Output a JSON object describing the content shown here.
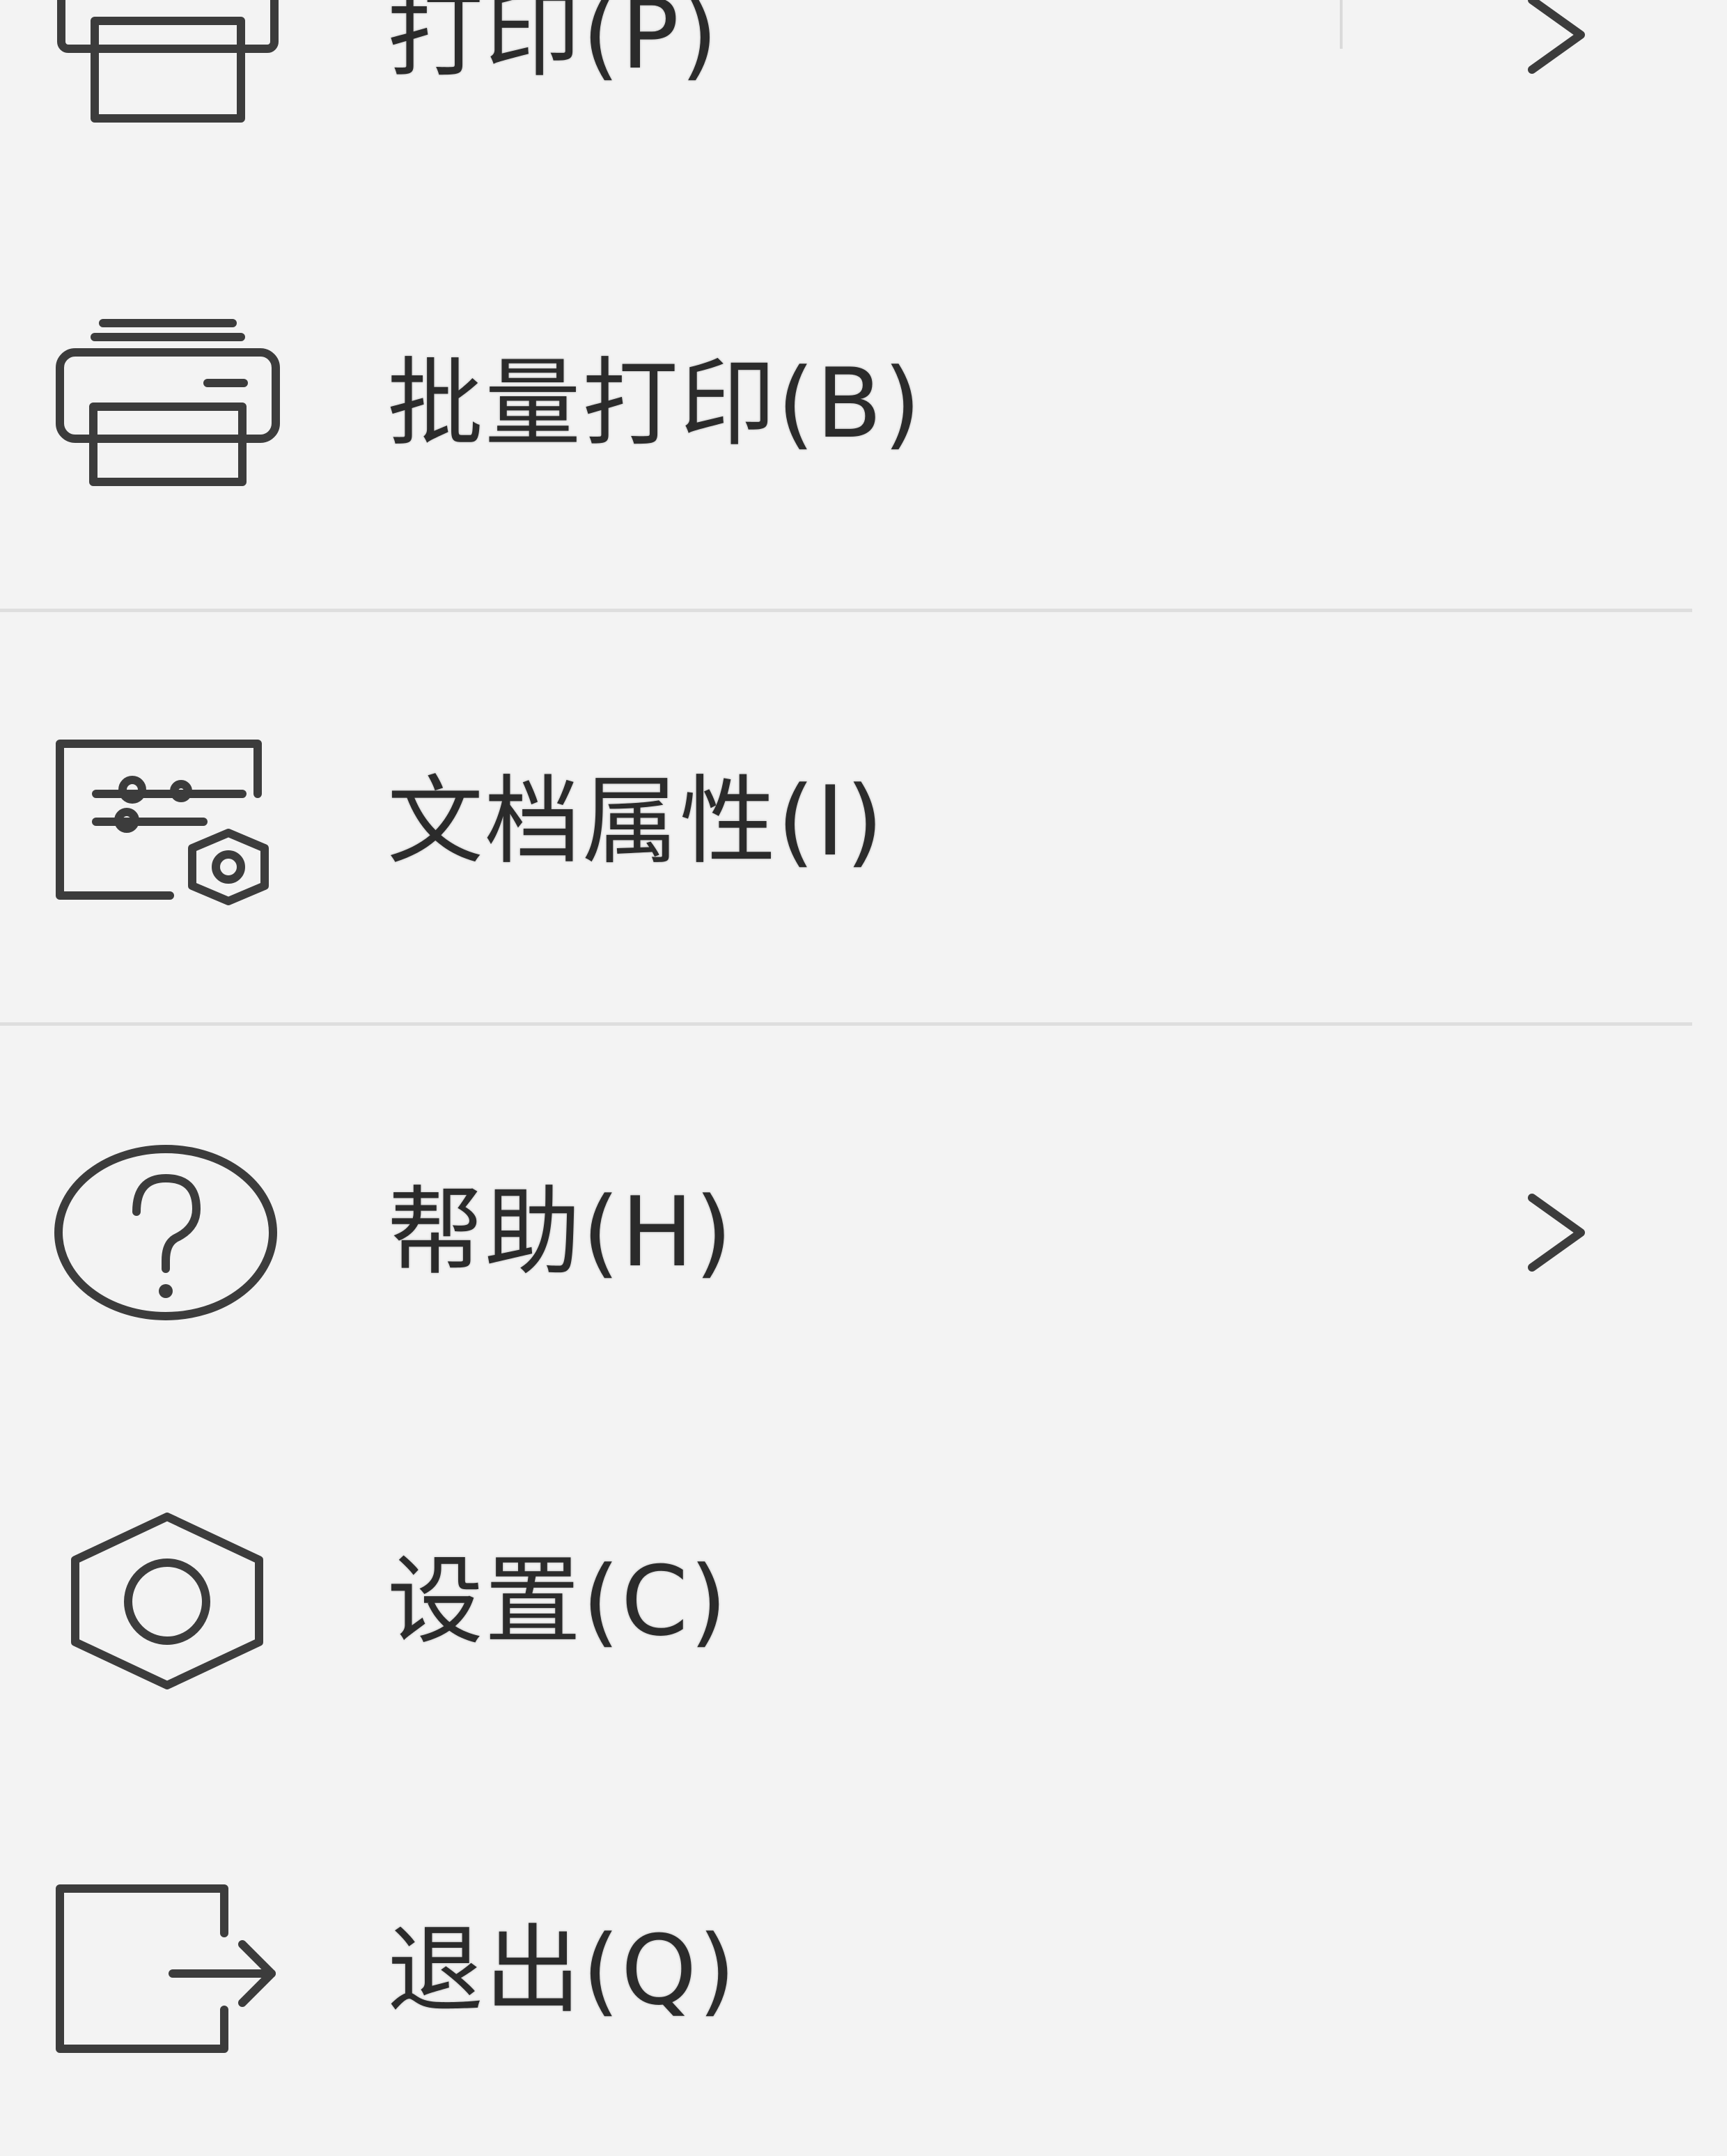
{
  "menu": {
    "items": [
      {
        "label": "打印(P)",
        "icon": "printer-icon",
        "has_submenu": true
      },
      {
        "label": "批量打印(B)",
        "icon": "batch-print-icon",
        "has_submenu": false
      },
      {
        "label": "文档属性(I)",
        "icon": "document-properties-icon",
        "has_submenu": false
      },
      {
        "label": "帮助(H)",
        "icon": "help-icon",
        "has_submenu": true
      },
      {
        "label": "设置(C)",
        "icon": "settings-icon",
        "has_submenu": false
      },
      {
        "label": "退出(Q)",
        "icon": "exit-icon",
        "has_submenu": false
      }
    ]
  },
  "colors": {
    "background": "#f3f3f3",
    "text": "#2b2b2b",
    "icon_stroke": "#3c3c3c",
    "separator": "#dedede"
  }
}
